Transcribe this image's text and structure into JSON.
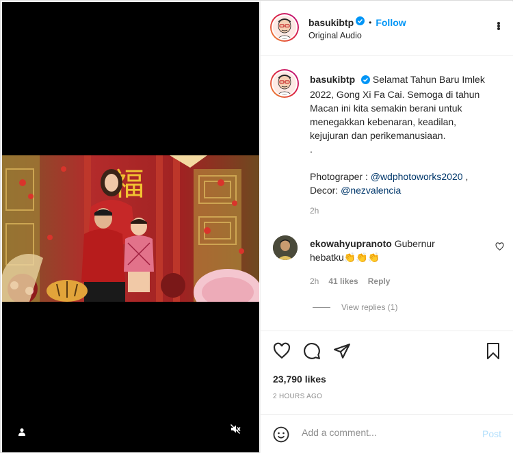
{
  "post": {
    "username": "basukibtp",
    "follow_label": "Follow",
    "dot": "•",
    "audio": "Original Audio"
  },
  "caption": {
    "username": "basukibtp",
    "line1": "Selamat Tahun Baru Imlek",
    "line2": "2022, Gong Xi Fa Cai. Semoga di tahun",
    "line3": "Macan ini kita semakin berani untuk",
    "line4": "menegakkan kebenaran, keadilan,",
    "line5": "kejujuran dan perikemanusiaan.",
    "line6": ".",
    "photographer_label": "Photograper :",
    "photographer_handle": "@wdphotoworks2020",
    "photographer_suffix": ",",
    "decor_label": "Decor:",
    "decor_handle": "@nezvalencia",
    "time": "2h"
  },
  "comment": {
    "username": "ekowahyupranoto",
    "text": "Gubernur",
    "text2": "hebatku👏👏👏",
    "time": "2h",
    "likes": "41 likes",
    "reply_label": "Reply",
    "view_replies": "View replies (1)"
  },
  "engagement": {
    "likes": "23,790 likes",
    "time_ago": "2 HOURS AGO"
  },
  "composer": {
    "placeholder": "Add a comment...",
    "post_label": "Post"
  },
  "colors": {
    "accent": "#0095f6",
    "link": "#00376b",
    "muted": "#8e8e8e",
    "post_disabled": "#b2dffc"
  }
}
